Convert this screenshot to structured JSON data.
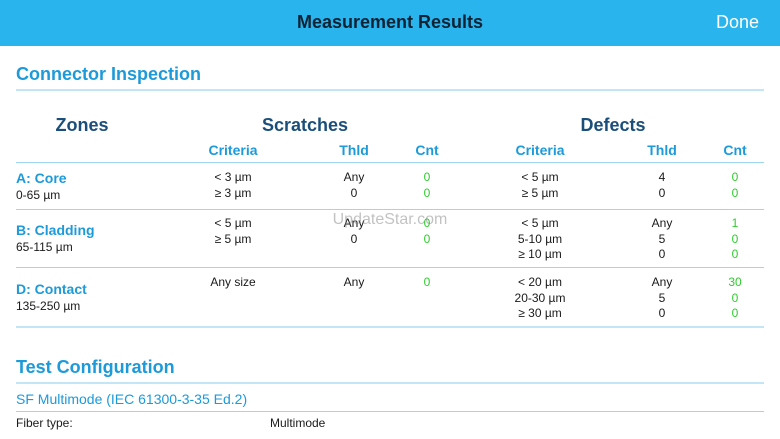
{
  "nav": {
    "title": "Measurement Results",
    "done": "Done"
  },
  "connector": {
    "title": "Connector Inspection",
    "headers": {
      "zones": "Zones",
      "scratches": "Scratches",
      "defects": "Defects",
      "criteria": "Criteria",
      "thld": "Thld",
      "cnt": "Cnt"
    },
    "zones": [
      {
        "name": "A: Core",
        "range": "0-65 µm",
        "scratch_criteria": [
          "< 3 µm",
          "≥ 3 µm"
        ],
        "scratch_thld": [
          "Any",
          "0"
        ],
        "scratch_cnt": [
          "0",
          "0"
        ],
        "defect_criteria": [
          "< 5 µm",
          "≥ 5 µm"
        ],
        "defect_thld": [
          "4",
          "0"
        ],
        "defect_cnt": [
          "0",
          "0"
        ]
      },
      {
        "name": "B: Cladding",
        "range": "65-115 µm",
        "scratch_criteria": [
          "< 5 µm",
          "≥ 5 µm"
        ],
        "scratch_thld": [
          "Any",
          "0"
        ],
        "scratch_cnt": [
          "0",
          "0"
        ],
        "defect_criteria": [
          "< 5 µm",
          "5-10 µm",
          "≥ 10 µm"
        ],
        "defect_thld": [
          "Any",
          "5",
          "0"
        ],
        "defect_cnt": [
          "1",
          "0",
          "0"
        ]
      },
      {
        "name": "D: Contact",
        "range": "135-250 µm",
        "scratch_criteria": [
          "Any size"
        ],
        "scratch_thld": [
          "Any"
        ],
        "scratch_cnt": [
          "0"
        ],
        "defect_criteria": [
          "< 20 µm",
          "20-30 µm",
          "≥ 30 µm"
        ],
        "defect_thld": [
          "Any",
          "5",
          "0"
        ],
        "defect_cnt": [
          "30",
          "0",
          "0"
        ]
      }
    ]
  },
  "watermark": "UpdateStar.com",
  "config": {
    "title": "Test Configuration",
    "standard": "SF Multimode  (IEC 61300-3-35 Ed.2)",
    "fiber_label": "Fiber type:",
    "fiber_value": "Multimode"
  },
  "colors": {
    "accent": "#2ab4ee",
    "heading": "#1c9ad9",
    "count": "#2ecc2e"
  }
}
